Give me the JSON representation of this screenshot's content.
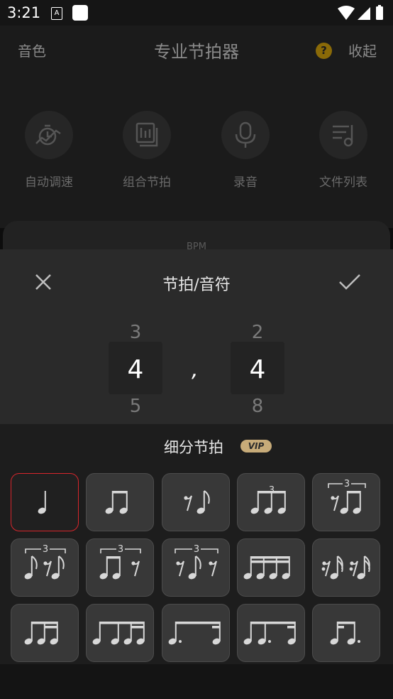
{
  "status_bar": {
    "time": "3:21",
    "a_icon": "A"
  },
  "header": {
    "left": "音色",
    "title": "专业节拍器",
    "help": "?",
    "right": "收起"
  },
  "tools": [
    {
      "label": "自动调速",
      "icon": "auto-speed-icon"
    },
    {
      "label": "组合节拍",
      "icon": "combo-beat-icon"
    },
    {
      "label": "录音",
      "icon": "microphone-icon"
    },
    {
      "label": "文件列表",
      "icon": "file-list-icon"
    }
  ],
  "bpm_label": "BPM",
  "sheet": {
    "title": "节拍/音符",
    "beats": {
      "above": "3",
      "selected": "4",
      "below": "5"
    },
    "separator": ",",
    "note": {
      "above": "2",
      "selected": "4",
      "below": "8"
    }
  },
  "subdivision": {
    "title": "细分节拍",
    "badge": "VIP",
    "selected_index": 0,
    "triplet_marker": "3",
    "patterns": [
      "quarter",
      "two-eighths",
      "eighth-rest-eighth",
      "triplet-eighths",
      "triplet-rest-two-eighths",
      "triplet-eighth-rest-eighth",
      "triplet-two-eighths-rest",
      "triplet-rest-eighth-rest",
      "four-sixteenths",
      "sixteenth-rests-sixteenths",
      "eighth-two-sixteenths",
      "quarter-eighth-two-sixteenths",
      "dotted-eighth-sixteenth",
      "eighth-dotted-eighth-sixteenth",
      "sixteenth-dotted-eighth"
    ]
  },
  "colors": {
    "accent_border": "#d8262c",
    "vip": "#c7ab79",
    "help": "#8a6a08"
  }
}
